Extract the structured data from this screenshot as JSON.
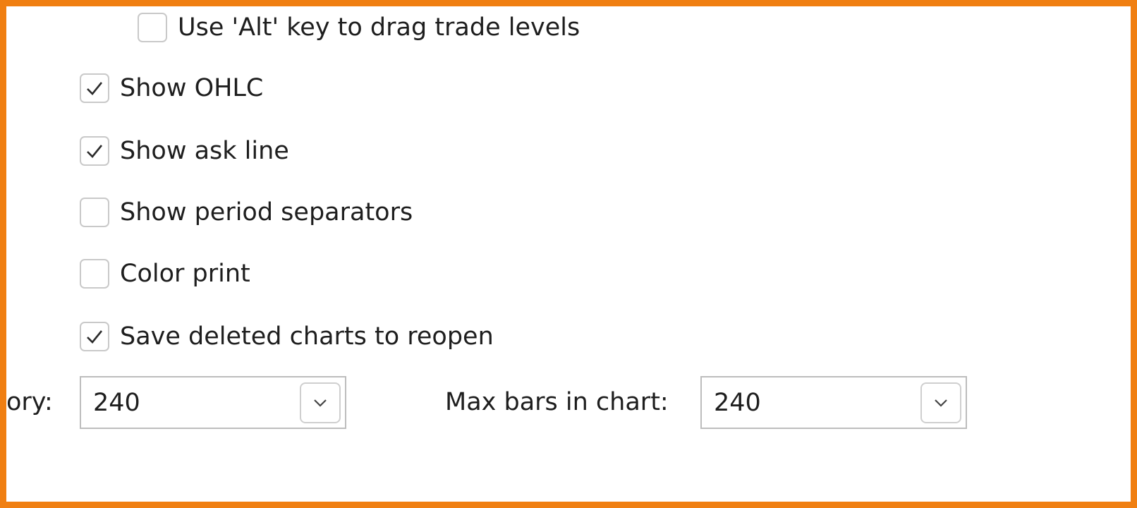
{
  "options": {
    "items": [
      {
        "label": "Use 'Alt' key to drag trade levels",
        "checked": false
      },
      {
        "label": "Show OHLC",
        "checked": true
      },
      {
        "label": "Show ask line",
        "checked": true
      },
      {
        "label": "Show period separators",
        "checked": false
      },
      {
        "label": "Color print",
        "checked": false
      },
      {
        "label": "Save deleted charts to reopen",
        "checked": true
      }
    ]
  },
  "history": {
    "label_partial": "ory:",
    "value": "240"
  },
  "max_bars": {
    "label": "Max bars in chart:",
    "value": "240"
  },
  "icons": {
    "check": "check-icon",
    "dropdown": "chevron-down-icon"
  },
  "colors": {
    "frame": "#f07f12"
  }
}
